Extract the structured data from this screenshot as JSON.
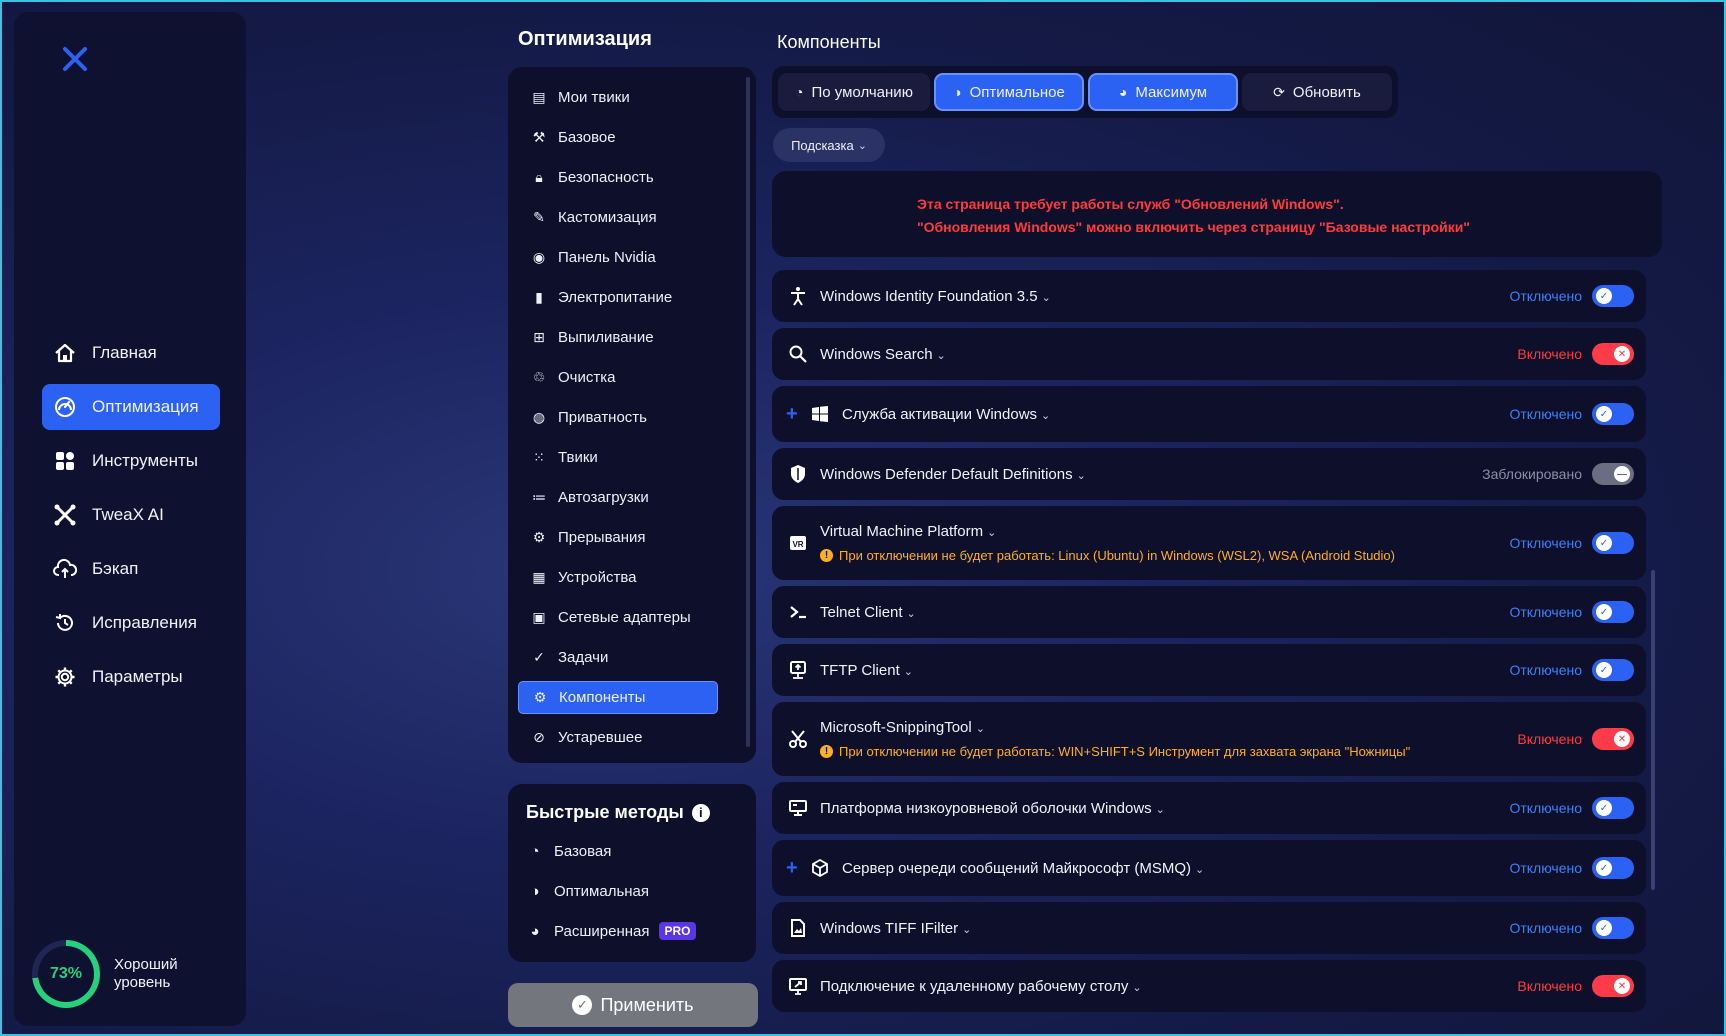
{
  "nav": {
    "items": [
      {
        "label": "Главная",
        "icon": "home-icon"
      },
      {
        "label": "Оптимизация",
        "icon": "gauge-icon",
        "active": true
      },
      {
        "label": "Инструменты",
        "icon": "grid-icon"
      },
      {
        "label": "TweaX AI",
        "icon": "ai-icon"
      },
      {
        "label": "Бэкап",
        "icon": "cloud-upload-icon"
      },
      {
        "label": "Исправления",
        "icon": "history-icon"
      },
      {
        "label": "Параметры",
        "icon": "gear-icon"
      }
    ],
    "score": {
      "value": "73%",
      "fraction": 0.73,
      "label": "Хороший уровень"
    }
  },
  "middle": {
    "title": "Оптимизация",
    "menu": [
      "Мои твики",
      "Базовое",
      "Безопасность",
      "Кастомизация",
      "Панель Nvidia",
      "Электропитание",
      "Выпиливание",
      "Очистка",
      "Приватность",
      "Твики",
      "Автозагрузки",
      "Прерывания",
      "Устройства",
      "Сетевые адаптеры",
      "Задачи",
      "Компоненты",
      "Устаревшее"
    ],
    "quick": {
      "title": "Быстрые методы",
      "items": [
        "Базовая",
        "Оптимальная",
        "Расширенная"
      ],
      "pro_badge": "PRO"
    },
    "apply_label": "Применить"
  },
  "right": {
    "title": "Компоненты",
    "modes": [
      "По умолчанию",
      "Оптимальное",
      "Максимум",
      "Обновить"
    ],
    "hint_label": "Подсказка",
    "warning": [
      "Эта страница требует работы служб \"Обновлений Windows\".",
      "\"Обновления Windows\" можно включить через страницу \"Базовые настройки\""
    ],
    "components": [
      {
        "name": "Windows Identity Foundation 3.5",
        "state": "Отключено",
        "kind": "off",
        "note": ""
      },
      {
        "name": "Windows Search",
        "state": "Включено",
        "kind": "on",
        "note": ""
      },
      {
        "name": "Служба активации Windows",
        "state": "Отключено",
        "kind": "off",
        "note": ""
      },
      {
        "name": "Windows Defender Default Definitions",
        "state": "Заблокировано",
        "kind": "lock",
        "note": ""
      },
      {
        "name": "Virtual Machine Platform",
        "state": "Отключено",
        "kind": "off",
        "note": "При отключении не будет работать: Linux (Ubuntu) in Windows (WSL2), WSA (Android Studio)"
      },
      {
        "name": "Telnet Client",
        "state": "Отключено",
        "kind": "off",
        "note": ""
      },
      {
        "name": "TFTP Client",
        "state": "Отключено",
        "kind": "off",
        "note": ""
      },
      {
        "name": "Microsoft-SnippingTool",
        "state": "Включено",
        "kind": "on",
        "note": "При отключении не будет работать: WIN+SHIFT+S Инструмент для захвата экрана \"Ножницы\""
      },
      {
        "name": "Платформа низкоуровневой оболочки Windows",
        "state": "Отключено",
        "kind": "off",
        "note": ""
      },
      {
        "name": "Сервер очереди сообщений Майкрософт (MSMQ)",
        "state": "Отключено",
        "kind": "off",
        "note": ""
      },
      {
        "name": "Windows TIFF IFilter",
        "state": "Отключено",
        "kind": "off",
        "note": ""
      },
      {
        "name": "Подключение к удаленному рабочему столу",
        "state": "Включено",
        "kind": "on",
        "note": ""
      }
    ]
  }
}
